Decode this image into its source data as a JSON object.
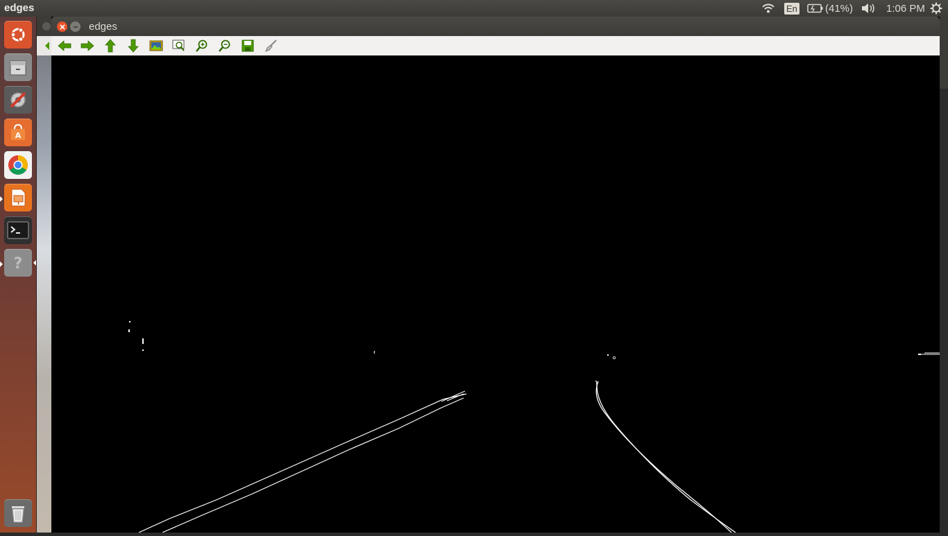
{
  "top_panel": {
    "app_title": "edges",
    "language": "En",
    "battery": "(41%)",
    "time": "1:06 PM",
    "icons": [
      "wifi-icon",
      "battery-icon",
      "volume-icon",
      "gear-icon"
    ]
  },
  "launcher": {
    "items": [
      {
        "name": "ubuntu-dash",
        "color": "#d9532c"
      },
      {
        "name": "files",
        "color": "#8a8a8a"
      },
      {
        "name": "system-settings",
        "color": "#5a5a5a"
      },
      {
        "name": "software-center",
        "color": "#e46d2f"
      },
      {
        "name": "chrome",
        "color": "#f2f2f2"
      },
      {
        "name": "libreoffice-impress",
        "color": "#e8731f"
      },
      {
        "name": "terminal",
        "color": "#2f2f2f"
      },
      {
        "name": "unknown-app",
        "color": "#8c8c8c"
      },
      {
        "name": "trash",
        "color": "#6b6b6b"
      }
    ]
  },
  "window": {
    "title": "edges",
    "toolbar": [
      "back",
      "forward",
      "up",
      "down",
      "image",
      "zoom-fit",
      "zoom-in",
      "zoom-out",
      "save",
      "properties"
    ]
  }
}
